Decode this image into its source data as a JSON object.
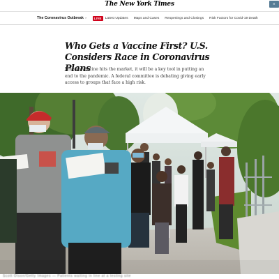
{
  "masthead": {
    "logo_text": "The New York Times",
    "button_icon": "menu-button"
  },
  "nav": {
    "section_label": "The Coronavirus Outbreak",
    "section_chevron": "›",
    "live_badge": "LIVE",
    "links": [
      "Latest Updates",
      "Maps and Cases",
      "Reopenings and Closings",
      "Risk Factors for Covid-19 Death"
    ]
  },
  "article": {
    "headline": "Who Gets a Vaccine First? U.S. Considers Race in Coronavirus Plans",
    "summary": "When a vaccine hits the market, it will be a key tool in putting an end to the pandemic. A federal committee is debating giving early access to groups that face a high risk."
  },
  "photo": {
    "description_icon": "photo-people-waiting-in-line",
    "credit_text": "Scott Olson/Getty Images — Patients waiting in line at a testing site"
  },
  "colors": {
    "live_red": "#d0021b",
    "masthead_button": "#567b95",
    "tent_white": "#f4f6f7",
    "foliage_green": "#4f7a2e"
  }
}
